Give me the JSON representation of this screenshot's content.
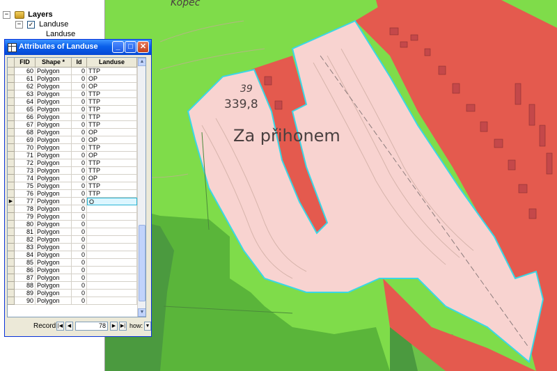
{
  "toc": {
    "root_label": "Layers",
    "layer_label": "Landuse",
    "legend_label": "Landuse"
  },
  "map": {
    "place_label": "Za přihonem",
    "elevation_number": "39",
    "elevation_value": "339,8",
    "top_label": "Kopec"
  },
  "window": {
    "title": "Attributes of Landuse",
    "minimize_glyph": "_",
    "maximize_glyph": "□",
    "close_glyph": "✕"
  },
  "table": {
    "columns": [
      "FID",
      "Shape *",
      "Id",
      "Landuse"
    ],
    "rows": [
      {
        "fid": "60",
        "shape": "Polygon",
        "id": "0",
        "landuse": "TTP"
      },
      {
        "fid": "61",
        "shape": "Polygon",
        "id": "0",
        "landuse": "OP"
      },
      {
        "fid": "62",
        "shape": "Polygon",
        "id": "0",
        "landuse": "OP"
      },
      {
        "fid": "63",
        "shape": "Polygon",
        "id": "0",
        "landuse": "TTP"
      },
      {
        "fid": "64",
        "shape": "Polygon",
        "id": "0",
        "landuse": "TTP"
      },
      {
        "fid": "65",
        "shape": "Polygon",
        "id": "0",
        "landuse": "TTP"
      },
      {
        "fid": "66",
        "shape": "Polygon",
        "id": "0",
        "landuse": "TTP"
      },
      {
        "fid": "67",
        "shape": "Polygon",
        "id": "0",
        "landuse": "TTP"
      },
      {
        "fid": "68",
        "shape": "Polygon",
        "id": "0",
        "landuse": "OP"
      },
      {
        "fid": "69",
        "shape": "Polygon",
        "id": "0",
        "landuse": "OP"
      },
      {
        "fid": "70",
        "shape": "Polygon",
        "id": "0",
        "landuse": "TTP"
      },
      {
        "fid": "71",
        "shape": "Polygon",
        "id": "0",
        "landuse": "OP"
      },
      {
        "fid": "72",
        "shape": "Polygon",
        "id": "0",
        "landuse": "TTP"
      },
      {
        "fid": "73",
        "shape": "Polygon",
        "id": "0",
        "landuse": "TTP"
      },
      {
        "fid": "74",
        "shape": "Polygon",
        "id": "0",
        "landuse": "OP"
      },
      {
        "fid": "75",
        "shape": "Polygon",
        "id": "0",
        "landuse": "TTP"
      },
      {
        "fid": "76",
        "shape": "Polygon",
        "id": "0",
        "landuse": "TTP"
      },
      {
        "fid": "77",
        "shape": "Polygon",
        "id": "0",
        "landuse": "O",
        "active": true
      },
      {
        "fid": "78",
        "shape": "Polygon",
        "id": "0",
        "landuse": ""
      },
      {
        "fid": "79",
        "shape": "Polygon",
        "id": "0",
        "landuse": ""
      },
      {
        "fid": "80",
        "shape": "Polygon",
        "id": "0",
        "landuse": ""
      },
      {
        "fid": "81",
        "shape": "Polygon",
        "id": "0",
        "landuse": ""
      },
      {
        "fid": "82",
        "shape": "Polygon",
        "id": "0",
        "landuse": ""
      },
      {
        "fid": "83",
        "shape": "Polygon",
        "id": "0",
        "landuse": ""
      },
      {
        "fid": "84",
        "shape": "Polygon",
        "id": "0",
        "landuse": ""
      },
      {
        "fid": "85",
        "shape": "Polygon",
        "id": "0",
        "landuse": ""
      },
      {
        "fid": "86",
        "shape": "Polygon",
        "id": "0",
        "landuse": ""
      },
      {
        "fid": "87",
        "shape": "Polygon",
        "id": "0",
        "landuse": ""
      },
      {
        "fid": "88",
        "shape": "Polygon",
        "id": "0",
        "landuse": ""
      },
      {
        "fid": "89",
        "shape": "Polygon",
        "id": "0",
        "landuse": ""
      },
      {
        "fid": "90",
        "shape": "Polygon",
        "id": "0",
        "landuse": ""
      }
    ],
    "active_row_marker": "▶"
  },
  "nav": {
    "record_label": "Record:",
    "record_value": "78",
    "show_label": "how:",
    "first_glyph": "|◀",
    "prev_glyph": "◀",
    "next_glyph": "▶",
    "last_glyph": "▶|"
  },
  "colors": {
    "light_green": "#7fdc4a",
    "mid_green": "#5ab53a",
    "dark_green": "#4b9a3f",
    "red": "#e45a4e",
    "pink": "#f8d3d0",
    "cyan_outline": "#39d7e6"
  }
}
